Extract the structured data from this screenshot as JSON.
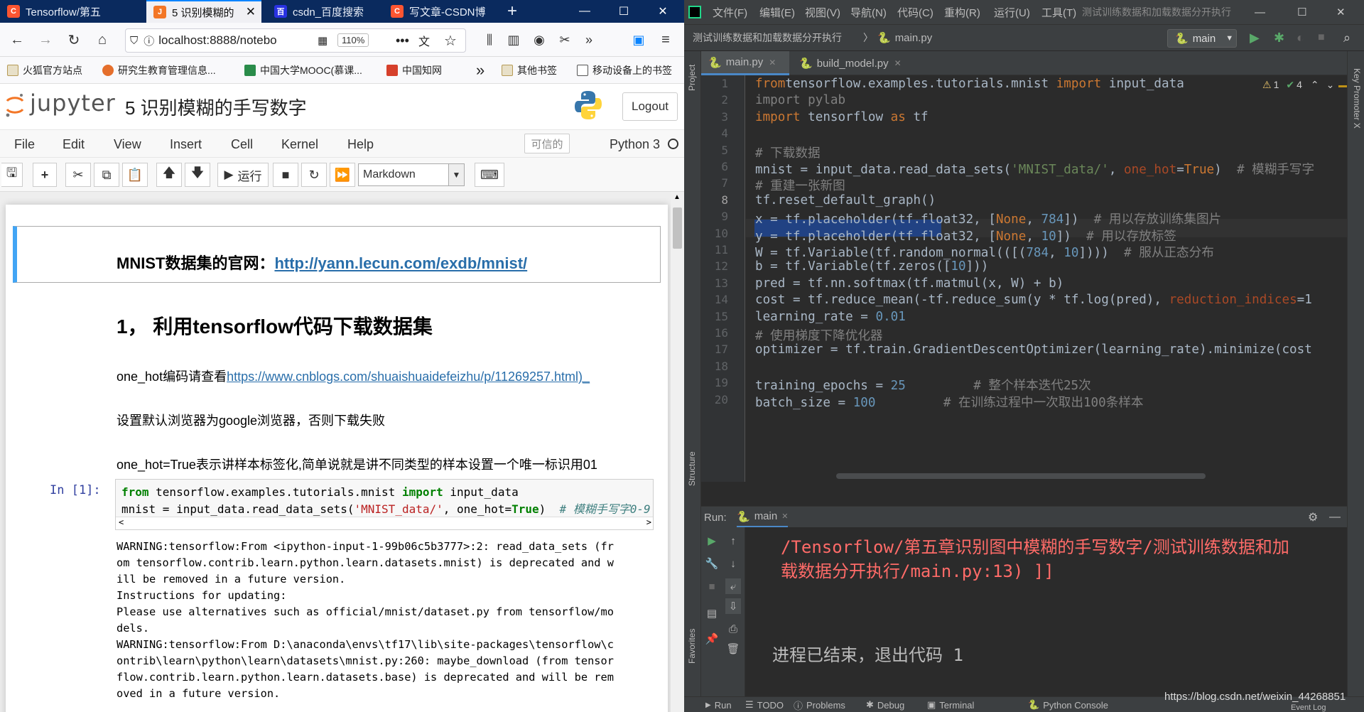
{
  "firefox": {
    "tabs": [
      {
        "label": "Tensorflow/第五",
        "icon": "csdn-icon"
      },
      {
        "label": "5 识别模糊的",
        "icon": "jupyter-icon"
      },
      {
        "label": "csdn_百度搜索",
        "icon": "baidu-icon"
      },
      {
        "label": "写文章-CSDN博",
        "icon": "csdn-icon"
      }
    ],
    "new_tab": "+",
    "url": "localhost:8888/notebo",
    "zoom": "110%",
    "bookmarks": [
      "火狐官方站点",
      "研究生教育管理信息...",
      "中国大学MOOC(慕课...",
      "中国知网",
      "其他书签",
      "移动设备上的书签"
    ],
    "bookmarks_more": "»"
  },
  "jupyter": {
    "brand": "jupyter",
    "notebook_title": "5 识别模糊的手写数字",
    "logout": "Logout",
    "menu": [
      "File",
      "Edit",
      "View",
      "Insert",
      "Cell",
      "Kernel",
      "Help"
    ],
    "trusted": "可信的",
    "kernel": "Python 3",
    "run_label": "运行",
    "cell_type": "Markdown",
    "md_heading_prefix": "MNIST数据集的官网：",
    "md_heading_link": "http://yann.lecun.com/exdb/mnist/",
    "section_title": "1， 利用tensorflow代码下载数据集",
    "p1_prefix": "one_hot编码请查看",
    "p1_link": "https://www.cnblogs.com/shuaishuaidefeizhu/p/11269257.html)_",
    "p2": "设置默认浏览器为google浏览器，否则下载失败",
    "p3": "one_hot=True表示讲样本标签化,简单说就是讲不同类型的样本设置一个唯一标识用01",
    "in_prompt": "In  [1]:",
    "code_line1": {
      "kw1": "from",
      "mid": " tensorflow.examples.tutorials.mnist ",
      "kw2": "import",
      "end": " input_data"
    },
    "code_line2": {
      "a": "mnist = input_data.read_data_sets(",
      "s": "'MNIST_data/'",
      "b": ", one_hot=",
      "kw": "True",
      "c": ")  ",
      "cm": "# 模糊手写字0-9"
    },
    "output": "WARNING:tensorflow:From <ipython-input-1-99b06c5b3777>:2: read_data_sets (fr\nom tensorflow.contrib.learn.python.learn.datasets.mnist) is deprecated and w\nill be removed in a future version.\nInstructions for updating:\nPlease use alternatives such as official/mnist/dataset.py from tensorflow/mo\ndels.\nWARNING:tensorflow:From D:\\anaconda\\envs\\tf17\\lib\\site-packages\\tensorflow\\c\nontrib\\learn\\python\\learn\\datasets\\mnist.py:260: maybe_download (from tensor\nflow.contrib.learn.python.learn.datasets.base) is deprecated and will be rem\noved in a future version."
  },
  "pycharm": {
    "menu": [
      "文件(F)",
      "编辑(E)",
      "视图(V)",
      "导航(N)",
      "代码(C)",
      "重构(R)",
      "运行(U)",
      "工具(T)"
    ],
    "window_title": "测试训练数据和加载数据分开执行",
    "breadcrumb_project": "测试训练数据和加载数据分开执行",
    "breadcrumb_file": "main.py",
    "run_config": "main",
    "editor_tabs": [
      "main.py",
      "build_model.py"
    ],
    "inspections": {
      "warnings": "1",
      "weak": "4"
    },
    "lines": [
      {
        "n": "1",
        "parts": [
          [
            "pk",
            "from"
          ],
          [
            "",
            "tensorflow.examples.tutorials.mnist "
          ],
          [
            "pk",
            "import"
          ],
          [
            "",
            " input_data"
          ]
        ]
      },
      {
        "n": "2",
        "parts": [
          [
            "pc",
            "import pylab"
          ]
        ]
      },
      {
        "n": "3",
        "parts": [
          [
            "pk",
            "import"
          ],
          [
            "",
            " tensorflow "
          ],
          [
            "pk",
            "as"
          ],
          [
            "",
            " tf"
          ]
        ]
      },
      {
        "n": "4",
        "parts": []
      },
      {
        "n": "5",
        "parts": [
          [
            "pc",
            "# 下载数据"
          ]
        ]
      },
      {
        "n": "6",
        "parts": [
          [
            "",
            "mnist = input_data.read_data_sets("
          ],
          [
            "ps",
            "'MNIST_data/'"
          ],
          [
            "",
            ", "
          ],
          [
            "pp",
            "one_hot"
          ],
          [
            "",
            "="
          ],
          [
            "pk",
            "True"
          ],
          [
            "",
            ")  "
          ],
          [
            "pc",
            "# 模糊手写字"
          ]
        ]
      },
      {
        "n": "7",
        "parts": [
          [
            "pc",
            "# 重建一张新图"
          ]
        ]
      },
      {
        "n": "8",
        "parts": [
          [
            "",
            "tf.reset_default_graph()"
          ]
        ]
      },
      {
        "n": "9",
        "parts": [
          [
            "",
            "x = tf.placeholder(tf.float32, ["
          ],
          [
            "pk",
            "None"
          ],
          [
            "",
            ", "
          ],
          [
            "pn",
            "784"
          ],
          [
            "",
            "])  "
          ],
          [
            "pc",
            "# 用以存放训练集图片"
          ]
        ]
      },
      {
        "n": "10",
        "parts": [
          [
            "",
            "y = tf.placeholder(tf.float32, ["
          ],
          [
            "pk",
            "None"
          ],
          [
            "",
            ", "
          ],
          [
            "pn",
            "10"
          ],
          [
            "",
            "])  "
          ],
          [
            "pc",
            "# 用以存放标签"
          ]
        ]
      },
      {
        "n": "11",
        "parts": [
          [
            "",
            "W = tf.Variable(tf.random_normal(([("
          ],
          [
            "pn",
            "784"
          ],
          [
            "",
            ", "
          ],
          [
            "pn",
            "10"
          ],
          [
            "",
            "])))  "
          ],
          [
            "pc",
            "# 服从正态分布"
          ]
        ]
      },
      {
        "n": "12",
        "parts": [
          [
            "",
            "b = tf.Variable(tf.zeros(["
          ],
          [
            "pn",
            "10"
          ],
          [
            "",
            "]))"
          ]
        ]
      },
      {
        "n": "13",
        "parts": [
          [
            "",
            "pred = tf.nn.softmax(tf.matmul(x, W) + b)"
          ]
        ]
      },
      {
        "n": "14",
        "parts": [
          [
            "",
            "cost = tf.reduce_mean(-tf.reduce_sum(y * tf.log(pred), "
          ],
          [
            "pp",
            "reduction_indices"
          ],
          [
            "",
            "=1"
          ]
        ]
      },
      {
        "n": "15",
        "parts": [
          [
            "",
            "learning_rate = "
          ],
          [
            "pn",
            "0.01"
          ]
        ]
      },
      {
        "n": "16",
        "parts": [
          [
            "pc",
            "# 使用梯度下降优化器"
          ]
        ]
      },
      {
        "n": "17",
        "parts": [
          [
            "",
            "optimizer = tf.train.GradientDescentOptimizer(learning_rate).minimize(cost"
          ]
        ]
      },
      {
        "n": "18",
        "parts": []
      },
      {
        "n": "19",
        "parts": [
          [
            "",
            "training_epochs = "
          ],
          [
            "pn",
            "25"
          ],
          [
            "",
            "         "
          ],
          [
            "pc",
            "# 整个样本迭代25次"
          ]
        ]
      },
      {
        "n": "20",
        "parts": [
          [
            "",
            "batch_size = "
          ],
          [
            "pn",
            "100"
          ],
          [
            "",
            "         "
          ],
          [
            "pc",
            "# 在训练过程中一次取出100条样本"
          ]
        ]
      }
    ],
    "run_label": "Run:",
    "run_tab": "main",
    "error_line1": "/Tensorflow/第五章识别图中模糊的手写数字/测试训练数据和加",
    "error_line2": "载数据分开执行/main.py:13) ]]",
    "exit_message": "进程已结束，退出代码 1",
    "side_labels": {
      "project": "Project",
      "structure": "Structure",
      "favorites": "Favorites",
      "key_promoter": "Key Promoter X"
    },
    "status_tabs": [
      "Run",
      "TODO",
      "Problems",
      "Debug",
      "Terminal",
      "Python Console"
    ],
    "event_log": "Event Log",
    "watermark": "https://blog.csdn.net/weixin_44268851"
  }
}
